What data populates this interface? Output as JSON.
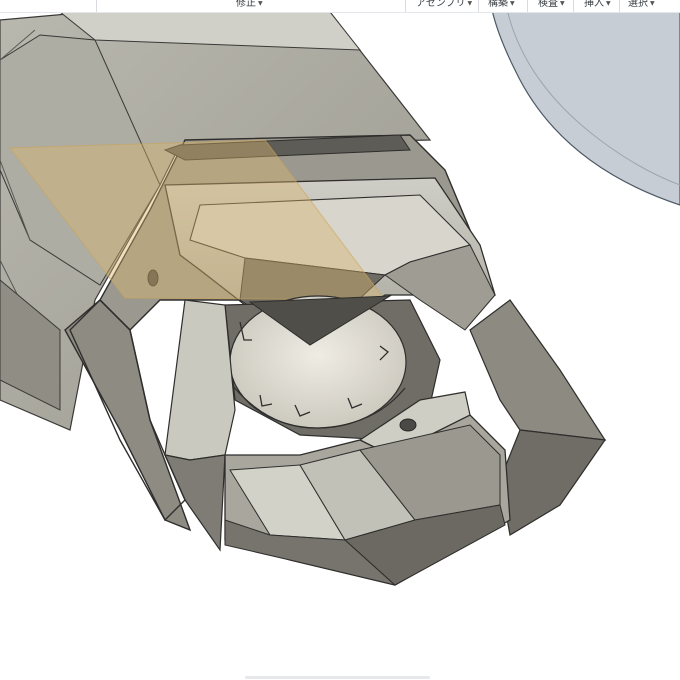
{
  "toolbar": {
    "items": [
      {
        "label": "修正",
        "icon": "chevron-down-icon"
      },
      {
        "label": "アセンブリ",
        "icon": "chevron-down-icon"
      },
      {
        "label": "構築",
        "icon": "chevron-down-icon"
      },
      {
        "label": "検査",
        "icon": "chevron-down-icon"
      },
      {
        "label": "挿入",
        "icon": "chevron-down-icon"
      },
      {
        "label": "選択",
        "icon": "chevron-down-icon"
      }
    ]
  },
  "viewport": {
    "content": "3D CAD model",
    "colors": {
      "background": "#ffffff",
      "body_light": "#bdbcb2",
      "body_mid": "#8f8d84",
      "body_dark": "#565550",
      "edge": "#2f2e2c",
      "highlight_plane": "#d9b56d",
      "disc": "#c6cdd4"
    }
  }
}
